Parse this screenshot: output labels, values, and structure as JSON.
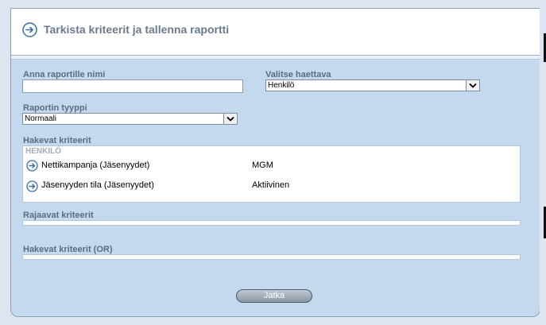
{
  "header": {
    "title": "Tarkista kriteerit ja tallenna raportti"
  },
  "form": {
    "report_name_label": "Anna raportille nimi",
    "report_name_value": "",
    "search_label": "Valitse haettava",
    "search_value": "Henkilö",
    "report_type_label": "Raportin tyyppi",
    "report_type_value": "Normaali"
  },
  "criteria": {
    "search_criteria_label": "Hakevat kriteerit",
    "group_label": "HENKILÖ",
    "items": [
      {
        "name": "Nettikampanja (Jäsenyydet)",
        "value": "MGM"
      },
      {
        "name": "Jäsenyyden tila (Jäsenyydet)",
        "value": "Aktiivinen"
      }
    ],
    "limiting_label": "Rajaavat kriteerit",
    "or_label": "Hakevat kriteerit (OR)"
  },
  "actions": {
    "continue_label": "Jatka"
  },
  "colors": {
    "panel_bg": "#c5d9ee",
    "label": "#5c6c80",
    "title": "#6a7a8c"
  },
  "icons": {
    "nav": "circle-arrow-right-icon",
    "dropdown": "chevron-down-icon"
  }
}
